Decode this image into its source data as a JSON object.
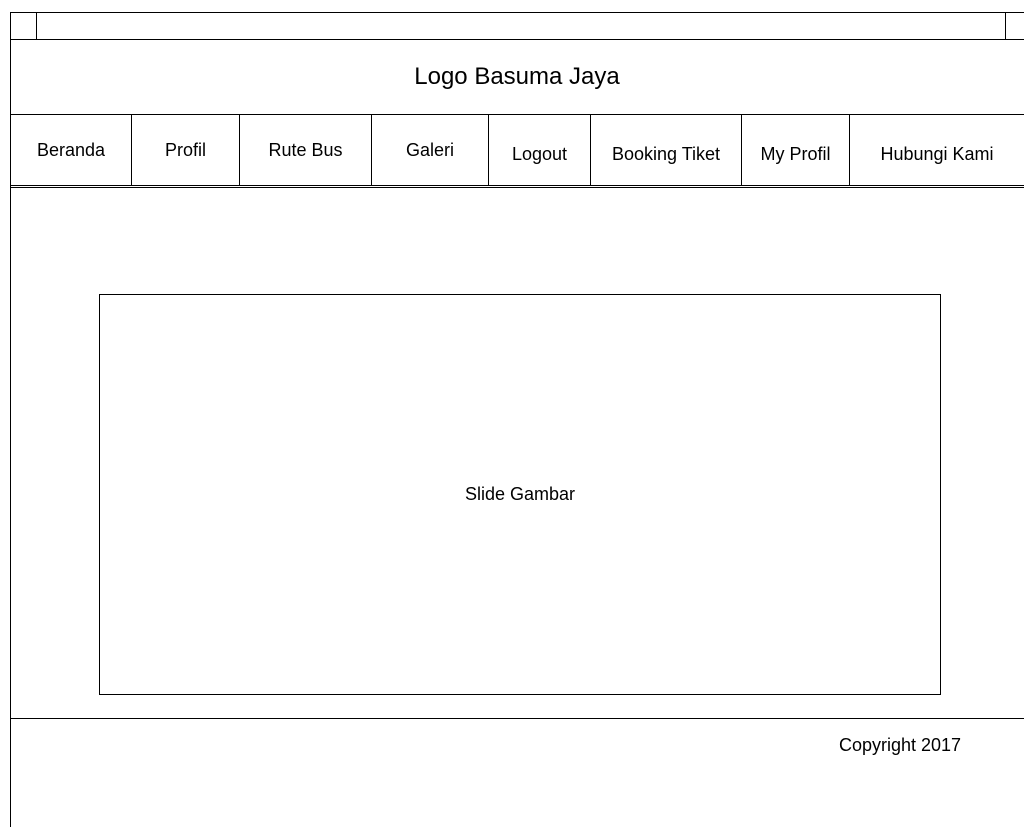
{
  "header": {
    "logo_text": "Logo Basuma Jaya"
  },
  "nav": {
    "items": [
      {
        "label": "Beranda"
      },
      {
        "label": "Profil"
      },
      {
        "label": "Rute Bus"
      },
      {
        "label": "Galeri"
      },
      {
        "label": "Logout"
      },
      {
        "label": "Booking Tiket"
      },
      {
        "label": "My Profil"
      },
      {
        "label": "Hubungi Kami"
      }
    ]
  },
  "main": {
    "slide_label": "Slide Gambar"
  },
  "footer": {
    "copyright": "Copyright 2017"
  }
}
